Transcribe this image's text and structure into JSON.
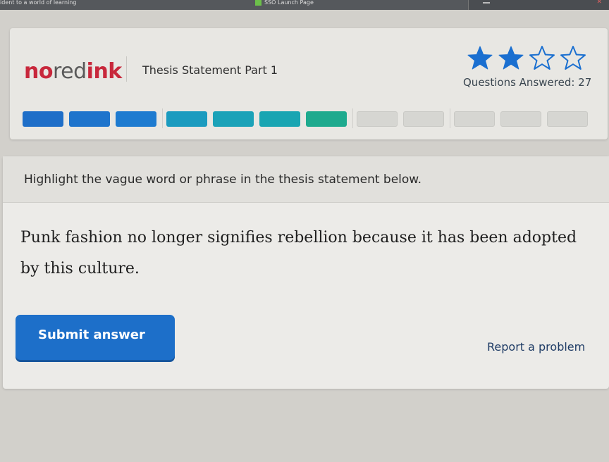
{
  "browser": {
    "crumb": "ident to a world of learning",
    "center_title": "SSO Launch Page"
  },
  "header": {
    "logo": {
      "no": "no",
      "red": "red",
      "ink": "ink"
    },
    "lesson_title": "Thesis Statement Part 1",
    "stars": {
      "filled": 2,
      "total": 4,
      "color": "#1a6fd0"
    },
    "questions_answered": "Questions Answered: 27",
    "progress": {
      "segments": [
        {
          "color": "#1e6ec8",
          "state": "complete"
        },
        {
          "color": "#1e74cc",
          "state": "complete"
        },
        {
          "color": "#1e7bd0",
          "state": "complete"
        },
        {
          "color": "#1b9bbf",
          "state": "complete"
        },
        {
          "color": "#1ba2b8",
          "state": "complete"
        },
        {
          "color": "#19a5b2",
          "state": "complete"
        },
        {
          "color": "#1eaa8e",
          "state": "complete"
        },
        {
          "color": "#d6d6d2",
          "state": "empty"
        },
        {
          "color": "#d6d6d2",
          "state": "empty"
        },
        {
          "color": "#d6d6d2",
          "state": "empty"
        },
        {
          "color": "#d6d6d2",
          "state": "empty"
        },
        {
          "color": "#d6d6d2",
          "state": "empty"
        }
      ]
    }
  },
  "question": {
    "prompt": "Highlight the vague word or phrase in the thesis statement below.",
    "thesis": "Punk fashion no longer signifies rebellion because it has been adopted by this culture.",
    "submit_label": "Submit answer",
    "report_label": "Report a problem"
  }
}
